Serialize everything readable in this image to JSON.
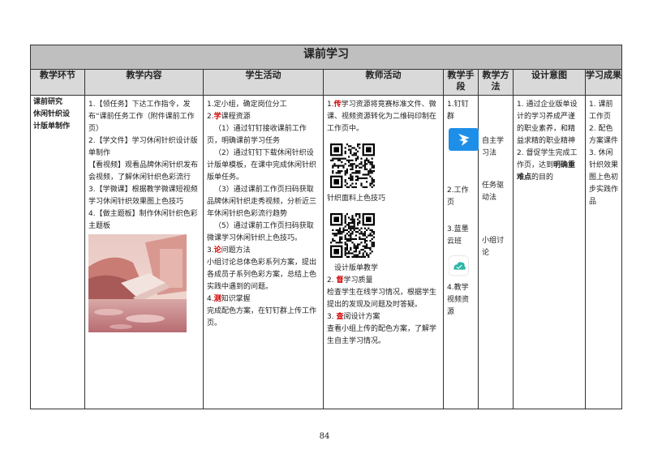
{
  "table": {
    "title": "课前学习",
    "headers": [
      "教学环节",
      "教学内容",
      "学生活动",
      "教师活动",
      "教学手段",
      "教学方法",
      "设计意图",
      "学习成果"
    ],
    "stage": [
      "课前研究",
      "休闲针织设",
      "计版单制作"
    ],
    "content": {
      "items": [
        "1.【领任务】下达工作指令，发布“课前任务工作（附件课前工作页）",
        "2.【学文件】学习休闲针织设计版单制作",
        "【看视频】观看品牌休闲针织发布会视频，了解休闲针织色彩流行",
        "3.【学微课】根据教学微课短视频学习休闲针织效果图上色技巧",
        "4.【做主题板】制作休闲针织色彩主题板"
      ],
      "image_label": "色彩主题板"
    },
    "student": {
      "item1": "1.定小组，确定岗位分工",
      "item2_num": "2.",
      "item2_red": "学",
      "item2_text": "课程资源",
      "sub": [
        "（1）通过钉钉接收课前工作页，明确课前学习任务",
        "（2）通过钉钉下载休闲针织设计版单模板，在课中完成休闲针织版单任务。",
        "（3）通过课前工作页扫码获取品牌休闲针织走秀视频，分析近三年休闲针织色彩流行趋势",
        "（5）通过课前工作页扫码获取微课学习休闲针织上色技巧。"
      ],
      "item3_num": "3.",
      "item3_red": "论",
      "item3_text": "问题方法",
      "item3_desc": "小组讨论总体色彩系列方案，提出各成员子系列色彩方案，总结上色实践中遇到的问题。",
      "item4_num": "4.",
      "item4_red": "测",
      "item4_text": "知识掌握",
      "item4_desc": "完成配色方案，在钉钉群上传工作页。"
    },
    "teacher": {
      "item1_num": "1.",
      "item1_red": "传",
      "item1_text": "学习资源将竞赛标准文件、微课、视频资源转化为二维码印制在工作页中。",
      "qr1_caption": "针织面料上色技巧",
      "qr2_caption": "设计版单教学",
      "item2_num": "2.",
      "item2_red": "督",
      "item2_text": "学习质量",
      "item2_desc": "检查学生在线学习情况，根据学生提出的发现及问题及时答疑。",
      "item3_num": "3.",
      "item3_red": "查",
      "item3_text": "阅设计方案",
      "item3_desc": "查看小组上传的配色方案，了解学生自主学习情况。"
    },
    "means": {
      "item1": "1.钉钉群",
      "item2": "2.工作页",
      "item3": "3.蓝墨云班",
      "item4": "4.教学视频资源"
    },
    "method": {
      "item1": "自主学习法",
      "item2": "任务驱动法",
      "item3": "小组讨论"
    },
    "intent": {
      "item1": "1. 通过企业版单设计的学习养成严谨的职业素养，和精益求精的职业精神",
      "item2_pre": "2. 督促学生完成工作页，达到",
      "item2_bold": "明确重难点",
      "item2_post": "的目的"
    },
    "outcome": {
      "item1": "1. 课前工作页",
      "item2": "2. 配色方案课件",
      "item3": "3. 休闲针织效果图上色初步实践作品"
    }
  },
  "page_number": "84",
  "colors": {
    "header_bg": "#bfbfbf",
    "subheader_bg": "#d9d9d9",
    "accent_red": "#d40000",
    "dingtalk_blue": "#1e8fe8",
    "lanmo_teal": "#2cb7a8"
  }
}
